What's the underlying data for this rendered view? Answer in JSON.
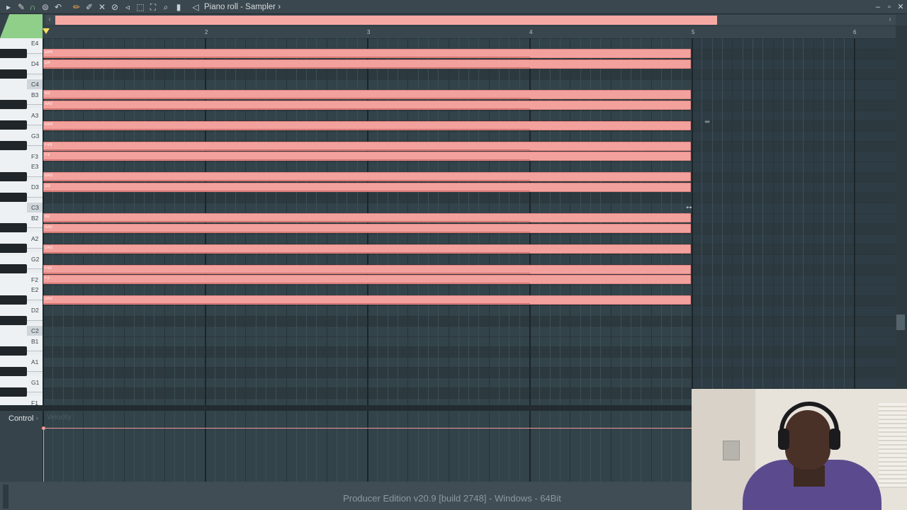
{
  "toolbar": {
    "title": "Piano roll - Sampler",
    "title_arrow": "›",
    "icons": [
      "arrow-right-icon",
      "wrench-icon",
      "magnet-icon",
      "snap-menu-icon",
      "undo-icon",
      "pencil-icon",
      "paint-brush-icon",
      "delete-tool-icon",
      "mute-tool-icon",
      "slice-tool-icon",
      "select-tool-icon",
      "zoom-tool-icon",
      "playback-tool-icon",
      "speaker-icon"
    ],
    "window_buttons": [
      "minimize-icon",
      "restore-icon",
      "close-icon"
    ]
  },
  "ruler": {
    "bars": [
      "2",
      "3",
      "4",
      "5",
      "6"
    ]
  },
  "keyboard": {
    "labels": [
      "E4",
      "D4",
      "C4",
      "B3",
      "A3",
      "G3",
      "F3",
      "E3",
      "D3",
      "C3",
      "B2",
      "A2",
      "G2",
      "F2",
      "E2",
      "D2",
      "C2",
      "B1",
      "A1",
      "G1",
      "F1"
    ]
  },
  "notes": [
    {
      "pitch": "D#4",
      "label": "D#4"
    },
    {
      "pitch": "D4",
      "label": "D4"
    },
    {
      "pitch": "B3",
      "label": "B3"
    },
    {
      "pitch": "A#3",
      "label": "A#3"
    },
    {
      "pitch": "G#3",
      "label": "G#3"
    },
    {
      "pitch": "F#3",
      "label": "F#3"
    },
    {
      "pitch": "F3",
      "label": "F3"
    },
    {
      "pitch": "D#3",
      "label": "D#3"
    },
    {
      "pitch": "D3",
      "label": "D3"
    },
    {
      "pitch": "B2",
      "label": "B2"
    },
    {
      "pitch": "A#2",
      "label": "A#2"
    },
    {
      "pitch": "G#2",
      "label": "G#2"
    },
    {
      "pitch": "F#2",
      "label": "F#2"
    },
    {
      "pitch": "F2",
      "label": "F2"
    },
    {
      "pitch": "D#2",
      "label": "D#2"
    }
  ],
  "note_length_bars": 4,
  "control": {
    "label": "Control",
    "arrow": "›",
    "parameter": "Velocity"
  },
  "status": {
    "text": "Producer Edition v20.9 [build 2748] - Windows - 64Bit"
  },
  "colors": {
    "note": "#f2a19d",
    "grid": "#33434a",
    "accent": "#8fcf8a"
  }
}
